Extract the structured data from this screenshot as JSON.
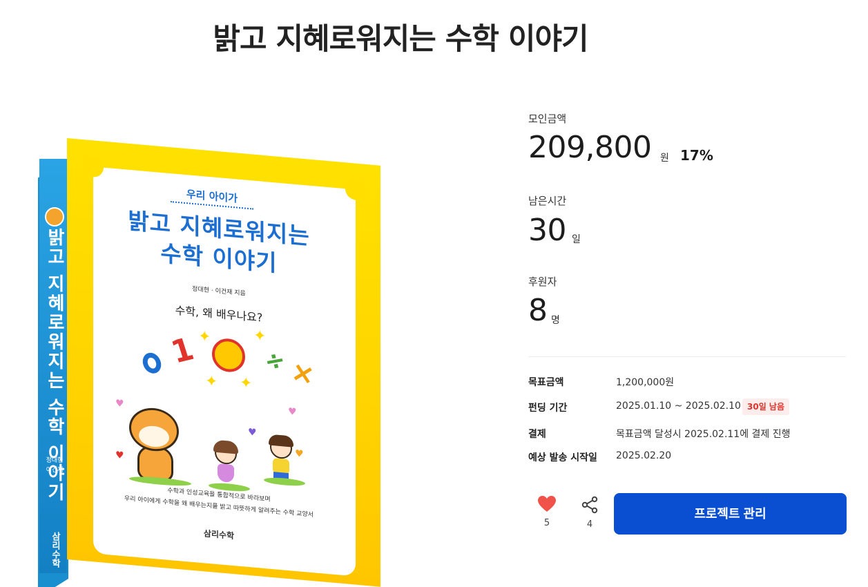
{
  "page": {
    "title": "밝고 지혜로워지는 수학 이야기"
  },
  "book_cover": {
    "subtitle": "우리 아이가",
    "title_line1": "밝고 지혜로워지는",
    "title_line2": "수학 이야기",
    "authors": "정대현 · 이건재 지음",
    "tagline": "수학, 왜 배우나요?",
    "desc_line1": "수학과 인성교육을 통합적으로 바라보며",
    "desc_line2": "우리 아이에게 수학을 왜 배우는지를 밝고 따뜻하게 알려주는 수학 교양서",
    "publisher": "삼리수학",
    "spine_title": "밝고 지혜로워지는 수학 이야기",
    "spine_authors": "정대현\n이건재",
    "spine_publisher": "삼리수학"
  },
  "stats": {
    "raised": {
      "label": "모인금액",
      "value": "209,800",
      "unit": "원",
      "percent": "17%"
    },
    "remaining": {
      "label": "남은시간",
      "value": "30",
      "unit": "일"
    },
    "backers": {
      "label": "후원자",
      "value": "8",
      "unit": "명"
    }
  },
  "details": [
    {
      "label": "목표금액",
      "value": "1,200,000원"
    },
    {
      "label": "펀딩 기간",
      "value": "2025.01.10 ~ 2025.02.10"
    },
    {
      "label": "결제",
      "value": "목표금액 달성시 2025.02.11에 결제 진행"
    },
    {
      "label": "예상 발송 시작일",
      "value": "2025.02.20"
    }
  ],
  "badge": {
    "text": "30일 남음"
  },
  "actions": {
    "like": {
      "icon": "heart-icon",
      "count": "5",
      "color": "#f0524a"
    },
    "share": {
      "icon": "share-icon",
      "count": "4"
    },
    "manage": {
      "label": "프로젝트 관리",
      "color": "#0a4fd1"
    }
  }
}
